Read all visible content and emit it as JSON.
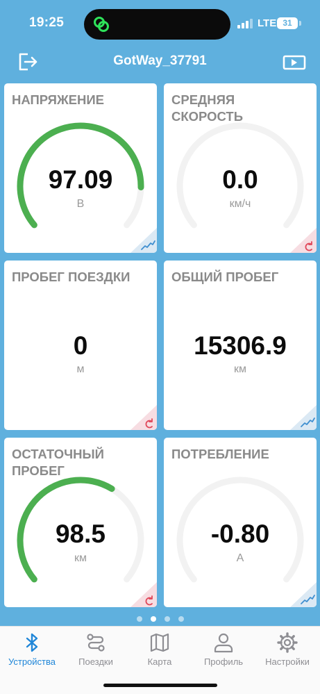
{
  "status_bar": {
    "time": "19:25",
    "network": "LTE",
    "battery": "31"
  },
  "header": {
    "title": "GotWay_37791"
  },
  "cards": [
    {
      "title": "НАПРЯЖЕНИЕ",
      "value": "97.09",
      "unit": "В",
      "gauge": true,
      "gauge_fill": 0.85,
      "corner": "chart"
    },
    {
      "title": "СРЕДНЯЯ СКОРОСТЬ",
      "value": "0.0",
      "unit": "км/ч",
      "gauge": true,
      "gauge_fill": 0.0,
      "corner": "reset"
    },
    {
      "title": "ПРОБЕГ ПОЕЗДКИ",
      "value": "0",
      "unit": "м",
      "gauge": false,
      "corner": "reset"
    },
    {
      "title": "ОБЩИЙ ПРОБЕГ",
      "value": "15306.9",
      "unit": "км",
      "gauge": false,
      "corner": "chart"
    },
    {
      "title": "ОСТАТОЧНЫЙ ПРОБЕГ",
      "value": "98.5",
      "unit": "км",
      "gauge": true,
      "gauge_fill": 0.62,
      "corner": "reset"
    },
    {
      "title": "ПОТРЕБЛЕНИЕ",
      "value": "-0.80",
      "unit": "А",
      "gauge": true,
      "gauge_fill": 0.0,
      "corner": "chart"
    }
  ],
  "pager": {
    "count": 4,
    "active": 1
  },
  "tabs": [
    {
      "label": "Устройства",
      "icon": "bluetooth-icon",
      "active": true
    },
    {
      "label": "Поездки",
      "icon": "route-icon",
      "active": false
    },
    {
      "label": "Карта",
      "icon": "map-icon",
      "active": false
    },
    {
      "label": "Профиль",
      "icon": "profile-icon",
      "active": false
    },
    {
      "label": "Настройки",
      "icon": "gear-icon",
      "active": false
    }
  ],
  "colors": {
    "background": "#5fb0de",
    "gauge_fill": "#4caf50",
    "gauge_track": "#f2f2f2",
    "chart_corner": "#dbe9f4",
    "reset_corner": "#f7dde2",
    "active_tab": "#1f86d8"
  }
}
